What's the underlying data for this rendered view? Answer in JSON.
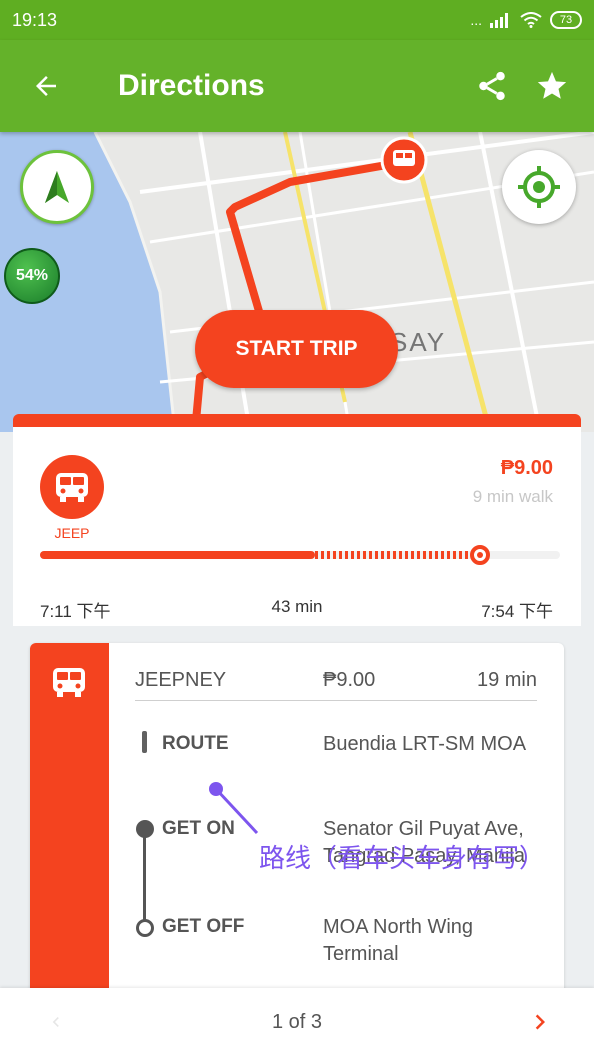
{
  "status_bar": {
    "time": "19:13",
    "signal_text": "...",
    "battery": "73"
  },
  "app_bar": {
    "title": "Directions",
    "back_icon": "arrow-left-icon",
    "share_icon": "share-icon",
    "favorite_icon": "star-icon",
    "color": "#64b22a"
  },
  "map": {
    "area_label": "SAY",
    "battery_bubble": "54%",
    "start_trip_label": "START TRIP",
    "route_color": "#f4431f"
  },
  "summary": {
    "mode_label": "JEEP",
    "fare": "₱9.00",
    "walk_note": "9 min walk",
    "depart_time": "7:11 下午",
    "duration": "43 min",
    "arrive_time": "7:54 下午",
    "ride_fraction": 0.63,
    "walk_fraction": 0.37
  },
  "leg": {
    "mode": "JEEPNEY",
    "fare": "₱9.00",
    "duration": "19 min",
    "route_label": "ROUTE",
    "route_value": "Buendia LRT-SM MOA",
    "get_on_label": "GET ON",
    "get_on_value": "Senator Gil Puyat Ave, Tangrad Pasay, Manila",
    "get_off_label": "GET OFF",
    "get_off_value": "MOA North Wing Terminal"
  },
  "annotation": {
    "text": "路线（看车头车身有写）",
    "color": "#7d55ee"
  },
  "pager": {
    "text": "1 of 3",
    "prev_icon": "chevron-left-icon",
    "next_icon": "chevron-right-icon"
  }
}
